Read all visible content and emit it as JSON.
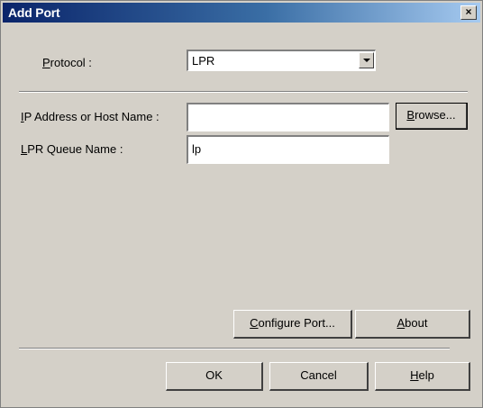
{
  "window": {
    "title": "Add Port",
    "close_glyph": "×"
  },
  "protocol": {
    "label_mnemonic": "P",
    "label_rest": "rotocol :",
    "selected": "LPR"
  },
  "ip_address": {
    "label_mnemonic": "I",
    "label_rest": "P Address or Host Name :",
    "value": ""
  },
  "browse_button": {
    "mnemonic": "B",
    "rest": "rowse..."
  },
  "queue_name": {
    "label_mnemonic": "L",
    "label_rest": "PR Queue Name :",
    "value": "lp"
  },
  "configure_button": {
    "mnemonic": "C",
    "rest": "onfigure Port..."
  },
  "about_button": {
    "mnemonic": "A",
    "rest": "bout"
  },
  "ok_button": {
    "label": "OK"
  },
  "cancel_button": {
    "label": "Cancel"
  },
  "help_button": {
    "mnemonic": "H",
    "rest": "elp"
  }
}
